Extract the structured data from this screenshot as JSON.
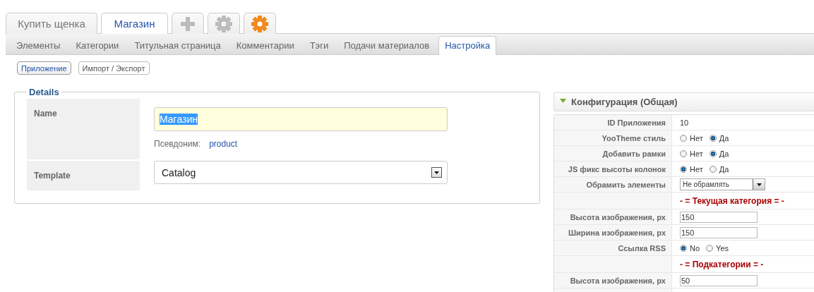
{
  "top_tabs": [
    {
      "kind": "text",
      "label": "Купить щенка",
      "selected": false
    },
    {
      "kind": "text",
      "label": "Магазин",
      "selected": true
    },
    {
      "kind": "add",
      "selected": false
    },
    {
      "kind": "settings",
      "selected": false
    },
    {
      "kind": "app",
      "selected": false
    }
  ],
  "sub_tabs": [
    {
      "label": "Элементы",
      "selected": false
    },
    {
      "label": "Категории",
      "selected": false
    },
    {
      "label": "Титульная страница",
      "selected": false
    },
    {
      "label": "Комментарии",
      "selected": false
    },
    {
      "label": "Тэги",
      "selected": false
    },
    {
      "label": "Подачи материалов",
      "selected": false
    },
    {
      "label": "Настройка",
      "selected": true
    }
  ],
  "section_buttons": [
    {
      "label": "Приложение",
      "selected": true
    },
    {
      "label": "Импорт / Экспорт",
      "selected": false
    }
  ],
  "details": {
    "legend": "Details",
    "name": {
      "label": "Name",
      "value": "Магазин",
      "highlighted": true,
      "alias_label": "Псевдоним:",
      "alias_value": "product"
    },
    "template": {
      "label": "Template",
      "value": "Catalog"
    }
  },
  "config": {
    "title": "Конфигурация (Общая)",
    "expanded": true,
    "rows": [
      {
        "kind": "text",
        "label": "ID Приложения",
        "value": "10"
      },
      {
        "kind": "radio",
        "label": "YooTheme стиль",
        "options": [
          {
            "label": "Нет",
            "selected": false
          },
          {
            "label": "Да",
            "selected": true
          }
        ]
      },
      {
        "kind": "radio",
        "label": "Добавить рамки",
        "options": [
          {
            "label": "Нет",
            "selected": false
          },
          {
            "label": "Да",
            "selected": true
          }
        ]
      },
      {
        "kind": "radio",
        "label": "JS фикс высоты колонок",
        "options": [
          {
            "label": "Нет",
            "selected": true
          },
          {
            "label": "Да",
            "selected": false
          }
        ]
      },
      {
        "kind": "select",
        "label": "Обрамить элементы",
        "value": "Не обрамлять"
      },
      {
        "kind": "heading",
        "value": "- = Текущая категория = -"
      },
      {
        "kind": "input",
        "label": "Высота изображения, px",
        "value": "150"
      },
      {
        "kind": "input",
        "label": "Ширина изображения, px",
        "value": "150"
      },
      {
        "kind": "radio",
        "label": "Ссылка RSS",
        "options": [
          {
            "label": "No",
            "selected": true
          },
          {
            "label": "Yes",
            "selected": false
          }
        ]
      },
      {
        "kind": "heading",
        "value": "- = Подкатегории = -"
      },
      {
        "kind": "input",
        "label": "Высота изображения, px",
        "value": "50"
      }
    ]
  }
}
